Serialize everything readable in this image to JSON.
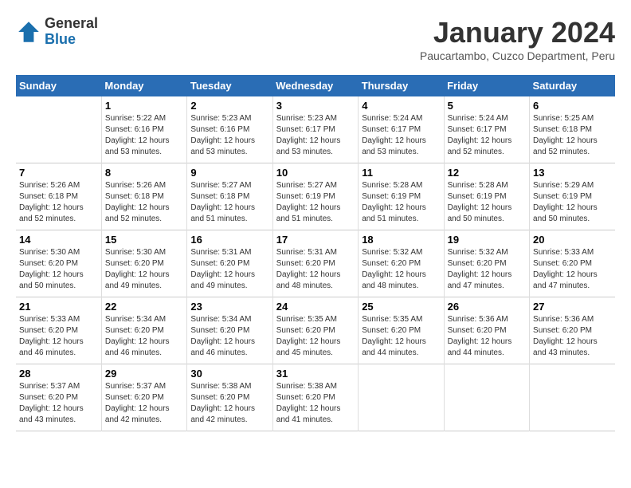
{
  "header": {
    "logo_general": "General",
    "logo_blue": "Blue",
    "title": "January 2024",
    "subtitle": "Paucartambo, Cuzco Department, Peru"
  },
  "columns": [
    "Sunday",
    "Monday",
    "Tuesday",
    "Wednesday",
    "Thursday",
    "Friday",
    "Saturday"
  ],
  "weeks": [
    [
      {
        "day": "",
        "info": ""
      },
      {
        "day": "1",
        "info": "Sunrise: 5:22 AM\nSunset: 6:16 PM\nDaylight: 12 hours\nand 53 minutes."
      },
      {
        "day": "2",
        "info": "Sunrise: 5:23 AM\nSunset: 6:16 PM\nDaylight: 12 hours\nand 53 minutes."
      },
      {
        "day": "3",
        "info": "Sunrise: 5:23 AM\nSunset: 6:17 PM\nDaylight: 12 hours\nand 53 minutes."
      },
      {
        "day": "4",
        "info": "Sunrise: 5:24 AM\nSunset: 6:17 PM\nDaylight: 12 hours\nand 53 minutes."
      },
      {
        "day": "5",
        "info": "Sunrise: 5:24 AM\nSunset: 6:17 PM\nDaylight: 12 hours\nand 52 minutes."
      },
      {
        "day": "6",
        "info": "Sunrise: 5:25 AM\nSunset: 6:18 PM\nDaylight: 12 hours\nand 52 minutes."
      }
    ],
    [
      {
        "day": "7",
        "info": "Sunrise: 5:26 AM\nSunset: 6:18 PM\nDaylight: 12 hours\nand 52 minutes."
      },
      {
        "day": "8",
        "info": "Sunrise: 5:26 AM\nSunset: 6:18 PM\nDaylight: 12 hours\nand 52 minutes."
      },
      {
        "day": "9",
        "info": "Sunrise: 5:27 AM\nSunset: 6:18 PM\nDaylight: 12 hours\nand 51 minutes."
      },
      {
        "day": "10",
        "info": "Sunrise: 5:27 AM\nSunset: 6:19 PM\nDaylight: 12 hours\nand 51 minutes."
      },
      {
        "day": "11",
        "info": "Sunrise: 5:28 AM\nSunset: 6:19 PM\nDaylight: 12 hours\nand 51 minutes."
      },
      {
        "day": "12",
        "info": "Sunrise: 5:28 AM\nSunset: 6:19 PM\nDaylight: 12 hours\nand 50 minutes."
      },
      {
        "day": "13",
        "info": "Sunrise: 5:29 AM\nSunset: 6:19 PM\nDaylight: 12 hours\nand 50 minutes."
      }
    ],
    [
      {
        "day": "14",
        "info": "Sunrise: 5:30 AM\nSunset: 6:20 PM\nDaylight: 12 hours\nand 50 minutes."
      },
      {
        "day": "15",
        "info": "Sunrise: 5:30 AM\nSunset: 6:20 PM\nDaylight: 12 hours\nand 49 minutes."
      },
      {
        "day": "16",
        "info": "Sunrise: 5:31 AM\nSunset: 6:20 PM\nDaylight: 12 hours\nand 49 minutes."
      },
      {
        "day": "17",
        "info": "Sunrise: 5:31 AM\nSunset: 6:20 PM\nDaylight: 12 hours\nand 48 minutes."
      },
      {
        "day": "18",
        "info": "Sunrise: 5:32 AM\nSunset: 6:20 PM\nDaylight: 12 hours\nand 48 minutes."
      },
      {
        "day": "19",
        "info": "Sunrise: 5:32 AM\nSunset: 6:20 PM\nDaylight: 12 hours\nand 47 minutes."
      },
      {
        "day": "20",
        "info": "Sunrise: 5:33 AM\nSunset: 6:20 PM\nDaylight: 12 hours\nand 47 minutes."
      }
    ],
    [
      {
        "day": "21",
        "info": "Sunrise: 5:33 AM\nSunset: 6:20 PM\nDaylight: 12 hours\nand 46 minutes."
      },
      {
        "day": "22",
        "info": "Sunrise: 5:34 AM\nSunset: 6:20 PM\nDaylight: 12 hours\nand 46 minutes."
      },
      {
        "day": "23",
        "info": "Sunrise: 5:34 AM\nSunset: 6:20 PM\nDaylight: 12 hours\nand 46 minutes."
      },
      {
        "day": "24",
        "info": "Sunrise: 5:35 AM\nSunset: 6:20 PM\nDaylight: 12 hours\nand 45 minutes."
      },
      {
        "day": "25",
        "info": "Sunrise: 5:35 AM\nSunset: 6:20 PM\nDaylight: 12 hours\nand 44 minutes."
      },
      {
        "day": "26",
        "info": "Sunrise: 5:36 AM\nSunset: 6:20 PM\nDaylight: 12 hours\nand 44 minutes."
      },
      {
        "day": "27",
        "info": "Sunrise: 5:36 AM\nSunset: 6:20 PM\nDaylight: 12 hours\nand 43 minutes."
      }
    ],
    [
      {
        "day": "28",
        "info": "Sunrise: 5:37 AM\nSunset: 6:20 PM\nDaylight: 12 hours\nand 43 minutes."
      },
      {
        "day": "29",
        "info": "Sunrise: 5:37 AM\nSunset: 6:20 PM\nDaylight: 12 hours\nand 42 minutes."
      },
      {
        "day": "30",
        "info": "Sunrise: 5:38 AM\nSunset: 6:20 PM\nDaylight: 12 hours\nand 42 minutes."
      },
      {
        "day": "31",
        "info": "Sunrise: 5:38 AM\nSunset: 6:20 PM\nDaylight: 12 hours\nand 41 minutes."
      },
      {
        "day": "",
        "info": ""
      },
      {
        "day": "",
        "info": ""
      },
      {
        "day": "",
        "info": ""
      }
    ]
  ]
}
